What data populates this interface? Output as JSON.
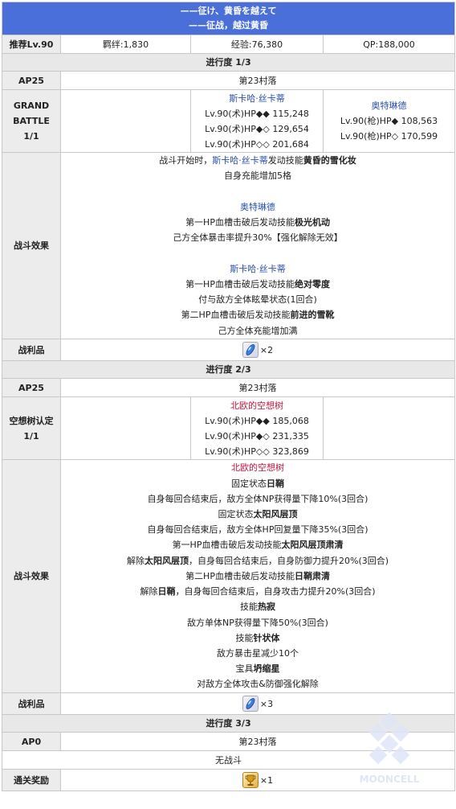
{
  "header": {
    "line1": "——征け、黄昏を越えて",
    "line2": "——征战，越过黄昏"
  },
  "summary": {
    "label": "推荐Lv.90",
    "bond": "羁绊:1,830",
    "exp": "经验:76,380",
    "qp": "QP:188,000"
  },
  "progress1": {
    "title": "进行度 1/3",
    "ap": "AP25",
    "location": "第23村落",
    "battle_label": [
      "GRAND",
      "BATTLE",
      "1/1"
    ],
    "enemy_a": {
      "name": "斯卡哈·丝卡蒂",
      "lines": [
        "Lv.90(术)HP◆◆ 115,248",
        "Lv.90(术)HP◆◇ 129,654",
        "Lv.90(术)HP◇◇ 201,684"
      ]
    },
    "enemy_b": {
      "name": "奥特琳德",
      "lines": [
        "Lv.90(枪)HP◆ 108,563",
        "Lv.90(枪)HP◇ 170,599"
      ]
    },
    "effects_label": "战斗效果",
    "effects": {
      "l1_a": "战斗开始时，",
      "l1_link": "斯卡哈·丝卡蒂",
      "l1_b": "发动技能",
      "l1_bold": "黄昏的雪化妆",
      "l2": "自身充能增加5格",
      "head2": "奥特琳德",
      "l3_a": "第一HP血槽击破后发动技能",
      "l3_bold": "极光机动",
      "l4": "己方全体暴击率提升30%【强化解除无效】",
      "head3": "斯卡哈·丝卡蒂",
      "l5_a": "第一HP血槽击破后发动技能",
      "l5_bold": "绝对零度",
      "l6": "付与敌方全体眩晕状态(1回合)",
      "l7_a": "第二HP血槽击破后发动技能",
      "l7_bold": "前进的雪靴",
      "l8": "己方全体充能增加满"
    },
    "loot_label": "战利品",
    "loot_count": "×2"
  },
  "progress2": {
    "title": "进行度 2/3",
    "ap": "AP25",
    "location": "第23村落",
    "battle_label": [
      "空想树认定",
      "1/1"
    ],
    "enemy": {
      "name": "北欧的空想树",
      "lines": [
        "Lv.90(术)HP◆◆ 185,068",
        "Lv.90(术)HP◆◇ 231,335",
        "Lv.90(术)HP◇◇ 323,869"
      ]
    },
    "effects_label": "战斗效果",
    "effects": {
      "head": "北欧的空想树",
      "f1_a": "固定状态",
      "f1_bold": "日鞘",
      "f2": "自身每回合结束后，敌方全体NP获得量下降10%(3回合)",
      "f3_a": "固定状态",
      "f3_bold": "太阳风层顶",
      "f4": "自身每回合结束后，敌方全体HP回复量下降35%(3回合)",
      "f5_a": "第一HP血槽击破后发动技能",
      "f5_bold": "太阳风层顶肃清",
      "f6_a": "解除",
      "f6_bold": "太阳风层顶",
      "f6_b": "，自身每回合结束后，自身防御力提升20%(3回合)",
      "f7_a": "第二HP血槽击破后发动技能",
      "f7_bold": "日鞘肃清",
      "f8_a": "解除",
      "f8_bold": "日鞘",
      "f8_b": "，自身每回合结束后，自身攻击力提升20%(3回合)",
      "f9_a": "技能",
      "f9_bold": "热寂",
      "f10": "敌方单体NP获得量下降50%(3回合)",
      "f11_a": "技能",
      "f11_bold": "针状体",
      "f12": "敌方暴击星减少10个",
      "f13_a": "宝具",
      "f13_bold": "坍缩星",
      "f14": "对敌方全体攻击&防御强化解除"
    },
    "loot_label": "战利品",
    "loot_count": "×3"
  },
  "progress3": {
    "title": "进行度 3/3",
    "ap": "AP0",
    "location": "第23村落",
    "no_battle": "无战斗"
  },
  "reward": {
    "label": "通关奖励",
    "count": "×1"
  },
  "watermark": "MOONCELL"
}
